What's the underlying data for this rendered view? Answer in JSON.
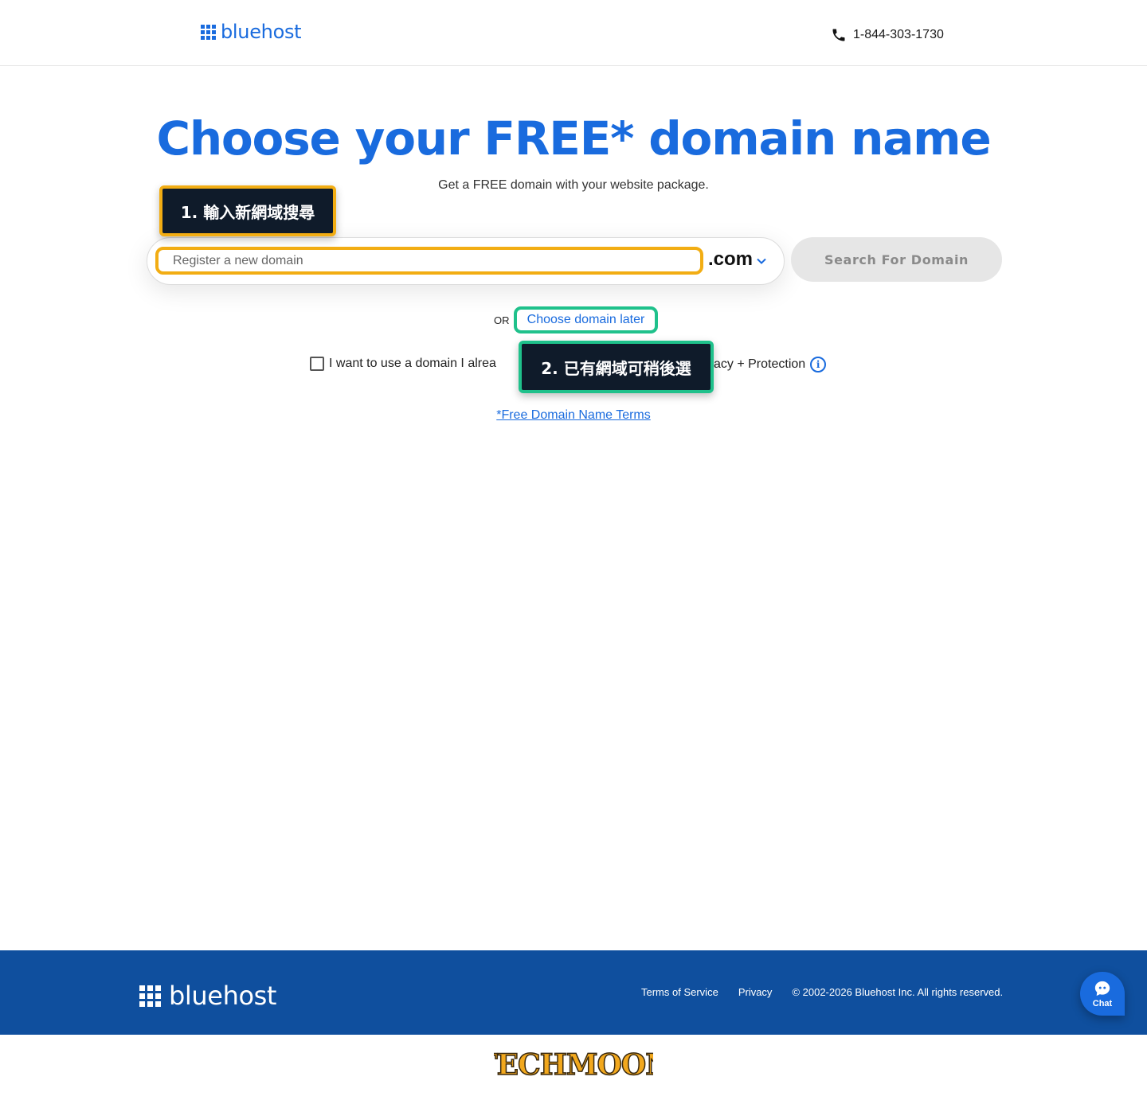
{
  "header": {
    "logo_text": "bluehost",
    "phone": "1-844-303-1730"
  },
  "hero": {
    "title": "Choose your FREE* domain name",
    "subtitle": "Get a FREE domain with your website package."
  },
  "search": {
    "placeholder": "Register a new domain",
    "value": "",
    "tld": ".com",
    "button_label": "Search For Domain"
  },
  "alt": {
    "or_label": "OR",
    "choose_later": "Choose domain later"
  },
  "existing": {
    "checkbox_label_visible": "I want to use a domain I alrea",
    "privacy_label_visible": "acy + Protection",
    "info_icon": "info-icon",
    "checked": false
  },
  "terms": {
    "label": "*Free Domain Name Terms"
  },
  "annotations": {
    "step1": "1. 輸入新網域搜尋",
    "step2": "2. 已有網域可稍後選",
    "step1_color": "#f2ad13",
    "step2_color": "#1fc18b"
  },
  "footer": {
    "logo_text": "bluehost",
    "links": [
      "Terms of Service",
      "Privacy"
    ],
    "copyright": "© 2002-2026 Bluehost Inc. All rights reserved.",
    "chat_label": "Chat"
  },
  "watermark": {
    "text": "TECHMOON"
  },
  "colors": {
    "brand": "#196bde",
    "footer_bg": "#0f4f9e",
    "button_disabled_bg": "#e6e6e6"
  }
}
